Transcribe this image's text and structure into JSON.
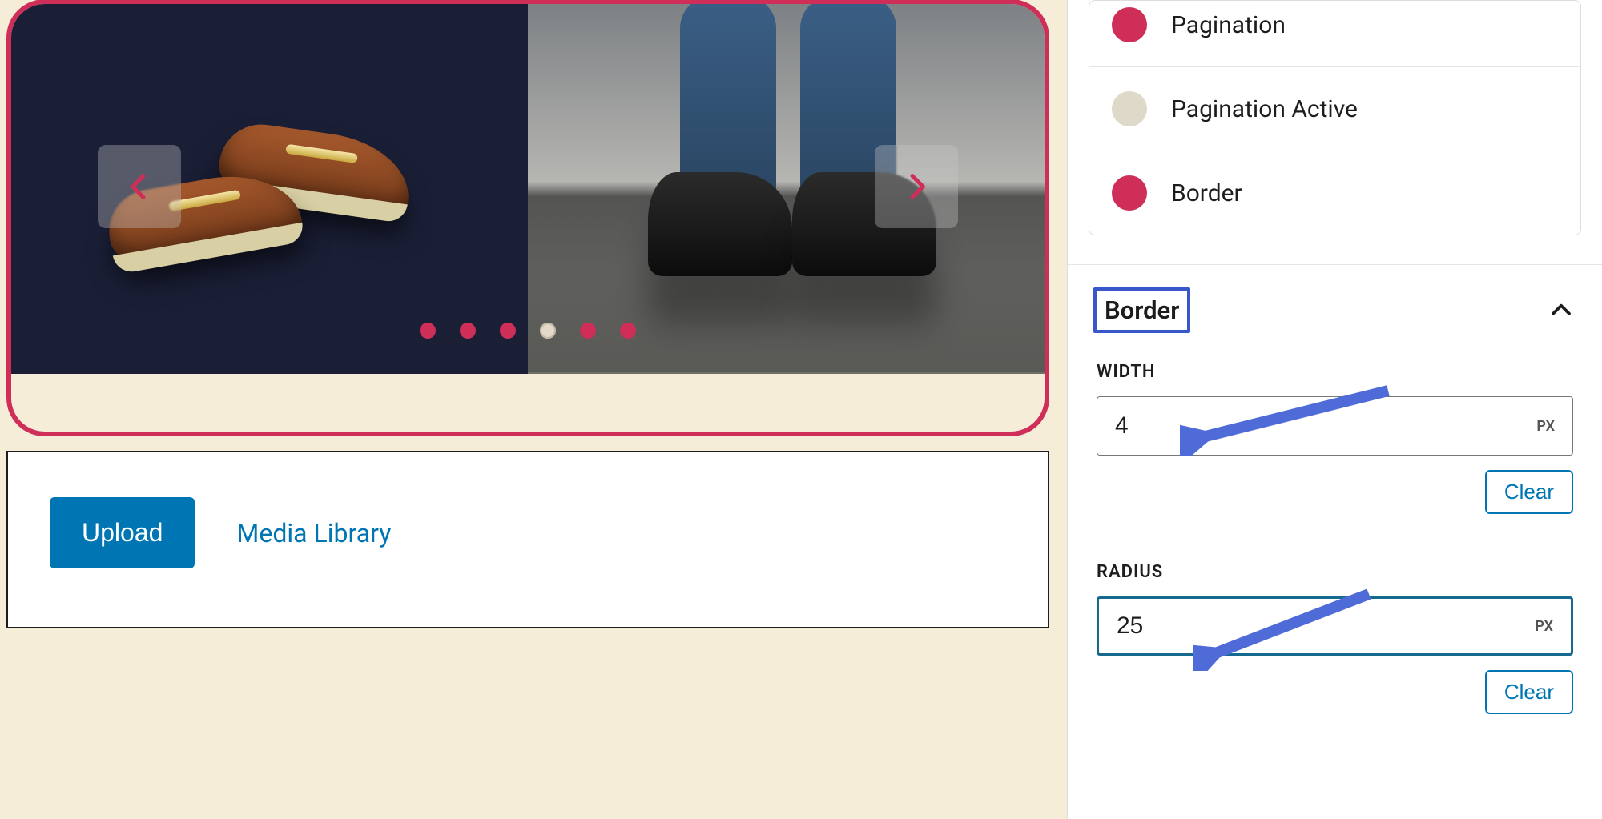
{
  "accent": "#cf2e58",
  "link_color": "#0075b3",
  "carousel": {
    "slide_count": 6,
    "active_index": 3
  },
  "media_panel": {
    "upload_label": "Upload",
    "library_label": "Media Library"
  },
  "color_settings": {
    "rows": [
      {
        "label": "Pagination",
        "color": "#cf2e58"
      },
      {
        "label": "Pagination Active",
        "color": "#ded9c8"
      },
      {
        "label": "Border",
        "color": "#cf2e58"
      }
    ]
  },
  "border_section": {
    "title": "Border",
    "expanded": true,
    "width": {
      "label": "WIDTH",
      "value": "4",
      "unit": "PX",
      "clear_label": "Clear"
    },
    "radius": {
      "label": "RADIUS",
      "value": "25",
      "unit": "PX",
      "clear_label": "Clear",
      "focused": true
    }
  }
}
